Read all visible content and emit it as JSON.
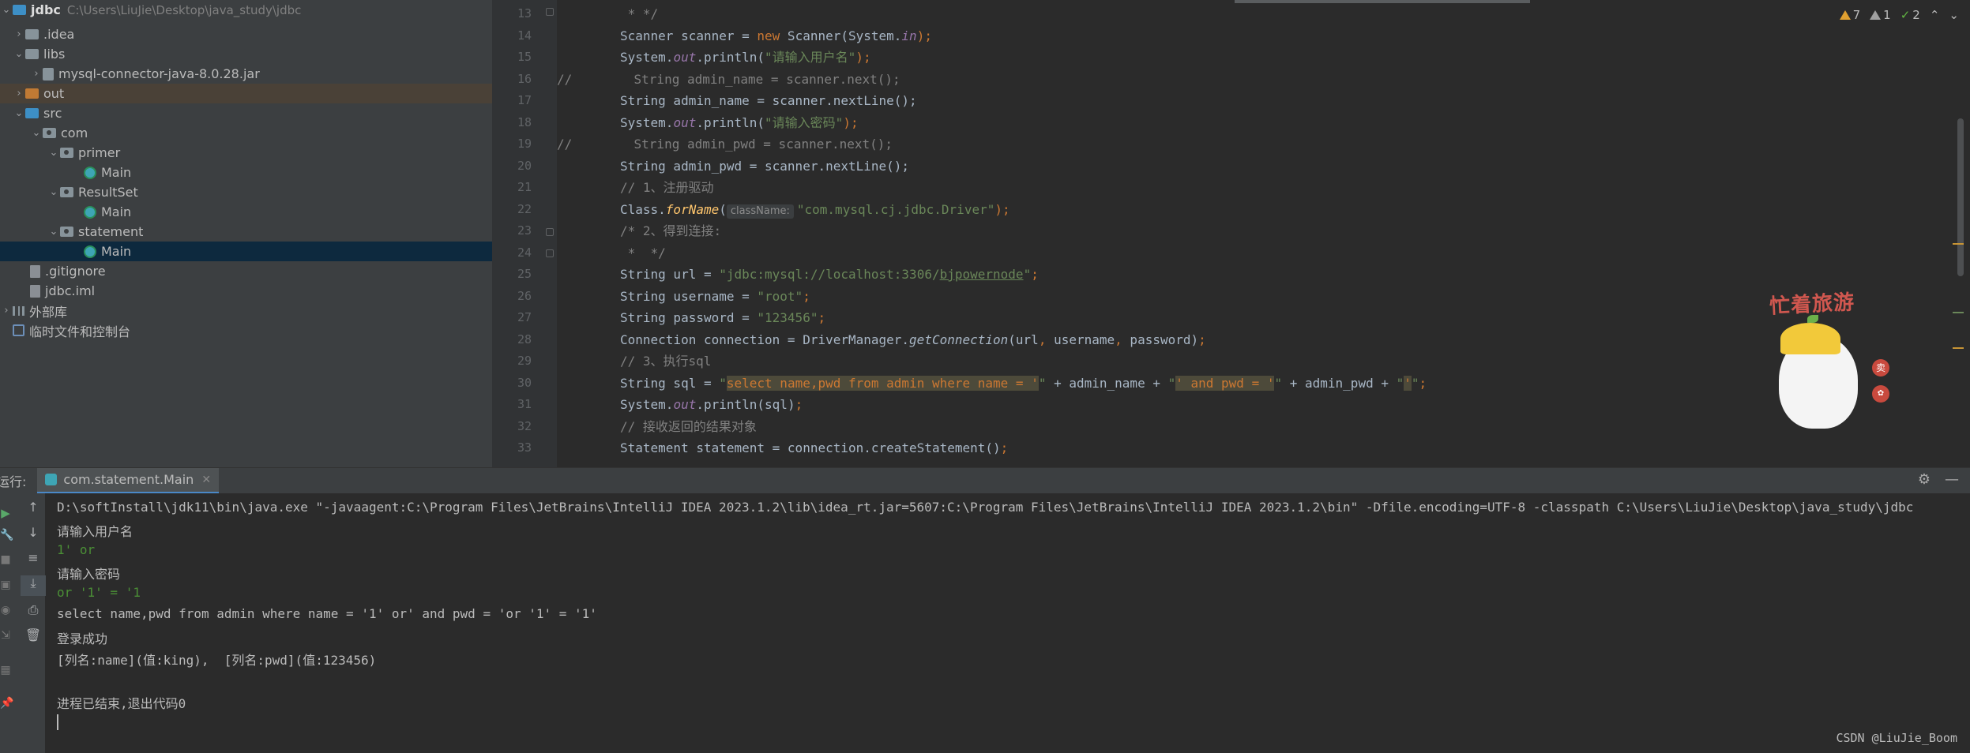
{
  "project_tree": {
    "root": {
      "name": "jdbc",
      "path": "C:\\Users\\LiuJie\\Desktop\\java_study\\jdbc"
    },
    "items": [
      {
        "label": ".idea",
        "kind": "folder"
      },
      {
        "label": "libs",
        "kind": "folder"
      },
      {
        "label": "mysql-connector-java-8.0.28.jar",
        "kind": "jar"
      },
      {
        "label": "out",
        "kind": "folder-excluded"
      },
      {
        "label": "src",
        "kind": "source-folder"
      },
      {
        "label": "com",
        "kind": "package"
      },
      {
        "label": "primer",
        "kind": "package"
      },
      {
        "label": "Main",
        "kind": "class"
      },
      {
        "label": "ResultSet",
        "kind": "package"
      },
      {
        "label": "Main",
        "kind": "class"
      },
      {
        "label": "statement",
        "kind": "package"
      },
      {
        "label": "Main",
        "kind": "class",
        "selected": true
      },
      {
        "label": ".gitignore",
        "kind": "file"
      },
      {
        "label": "jdbc.iml",
        "kind": "file"
      },
      {
        "label": "外部库",
        "kind": "library"
      },
      {
        "label": "临时文件和控制台",
        "kind": "scratches"
      }
    ]
  },
  "editor": {
    "line_numbers": [
      "13",
      "14",
      "15",
      "16",
      "17",
      "18",
      "19",
      "20",
      "21",
      "22",
      "23",
      "24",
      "25",
      "26",
      "27",
      "28",
      "29",
      "30",
      "31",
      "32",
      "33"
    ],
    "inlay_hint": "className:",
    "inspections": {
      "warnings": "7",
      "weak_warnings": "1",
      "typos": "2"
    },
    "code": {
      "l13": " * */",
      "l14_a": "Scanner scanner = ",
      "l14_b": "new",
      "l14_c": " Scanner(System.",
      "l14_d": "in",
      "l14_e": ");",
      "l15_a": "System.",
      "l15_b": "out",
      "l15_c": ".println(",
      "l15_d": "\"请输入用户名\"",
      "l15_e": ");",
      "l16_a": "//",
      "l16_b": "  String admin_name = scanner.next();",
      "l17_a": "String admin_name = scanner.nextLine();",
      "l18_a": "System.",
      "l18_b": "out",
      "l18_c": ".println(",
      "l18_d": "\"请输入密码\"",
      "l18_e": ");",
      "l19_a": "//",
      "l19_b": "  String admin_pwd = scanner.next();",
      "l20_a": "String admin_pwd = scanner.nextLine();",
      "l21": "// 1、注册驱动",
      "l22_a": "Class.",
      "l22_b": "forName",
      "l22_c": "(",
      "l22_d": "\"com.mysql.cj.jdbc.Driver\"",
      "l22_e": ");",
      "l23": "/* 2、得到连接:",
      "l24": " *  */",
      "l25_a": "String url = ",
      "l25_b": "\"jdbc:mysql://localhost:3306/",
      "l25_c": "bjpowernode",
      "l25_d": "\"",
      "l25_e": ";",
      "l26_a": "String username = ",
      "l26_b": "\"root\"",
      "l26_c": ";",
      "l27_a": "String password = ",
      "l27_b": "\"123456\"",
      "l27_c": ";",
      "l28_a": "Connection connection = DriverManager.",
      "l28_b": "getConnection",
      "l28_c": "(url",
      "l28_d": ",",
      "l28_e": " username",
      "l28_f": ",",
      "l28_g": " password)",
      "l28_h": ";",
      "l29": "// 3、执行sql",
      "l30_a": "String sql = ",
      "l30_b": "\"",
      "l30_c": "select name,pwd from admin where name = '",
      "l30_d": "\"",
      "l30_e": " + admin_name + ",
      "l30_f": "\"",
      "l30_g": "' and pwd = '",
      "l30_h": "\"",
      "l30_i": " + admin_pwd + ",
      "l30_j": "\"",
      "l30_k": "'",
      "l30_l": "\"",
      "l30_m": ";",
      "l31_a": "System.",
      "l31_b": "out",
      "l31_c": ".println(sql)",
      "l31_d": ";",
      "l32": "// 接收返回的结果对象",
      "l33_a": "Statement statement = connection.createStatement()",
      "l33_b": ";"
    }
  },
  "sticker": {
    "text": "忙着旅游",
    "badge": "卖"
  },
  "run_panel": {
    "label": "运行:",
    "tab": "com.statement.Main",
    "console": [
      {
        "text": "D:\\softInstall\\jdk11\\bin\\java.exe \"-javaagent:C:\\Program Files\\JetBrains\\IntelliJ IDEA 2023.1.2\\lib\\idea_rt.jar=5607:C:\\Program Files\\JetBrains\\IntelliJ IDEA 2023.1.2\\bin\" -Dfile.encoding=UTF-8 -classpath C:\\Users\\LiuJie\\Desktop\\java_study\\jdbc",
        "kind": "out"
      },
      {
        "text": "请输入用户名",
        "kind": "out"
      },
      {
        "text": "1' or",
        "kind": "in"
      },
      {
        "text": "请输入密码",
        "kind": "out"
      },
      {
        "text": "or '1' = '1",
        "kind": "in"
      },
      {
        "text": "select name,pwd from admin where name = '1' or' and pwd = 'or '1' = '1'",
        "kind": "out"
      },
      {
        "text": "登录成功",
        "kind": "out"
      },
      {
        "text": "[列名:name](值:king),  [列名:pwd](值:123456)",
        "kind": "out"
      },
      {
        "text": "",
        "kind": "out"
      },
      {
        "text": "进程已结束,退出代码0",
        "kind": "out"
      }
    ]
  },
  "watermark": "CSDN @LiuJie_Boom",
  "colors": {
    "keyword": "#cc7832",
    "string": "#6a8759",
    "comment": "#808080",
    "field": "#9876aa",
    "method": "#ffc66d",
    "input": "#4b8f36"
  }
}
